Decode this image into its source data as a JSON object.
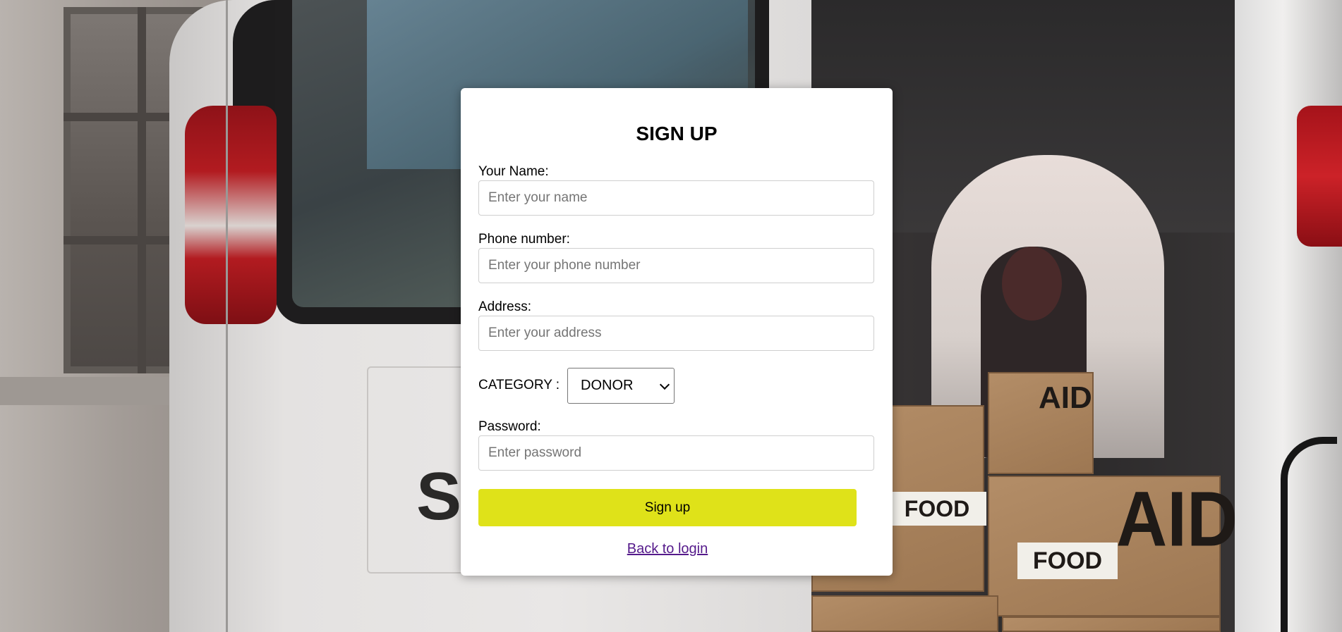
{
  "form": {
    "title": "SIGN UP",
    "name_label": "Your Name:",
    "name_placeholder": "Enter your name",
    "phone_label": "Phone number:",
    "phone_placeholder": "Enter your phone number",
    "address_label": "Address:",
    "address_placeholder": "Enter your address",
    "category_label": "CATEGORY :",
    "category_selected": "DONOR",
    "password_label": "Password:",
    "password_placeholder": "Enter password",
    "submit_label": "Sign up",
    "back_link": "Back to login"
  },
  "background": {
    "box_labels": [
      "AID",
      "AID",
      "FOOD",
      "FOOD"
    ],
    "van_letters": "SU"
  },
  "colors": {
    "button": "#dfe219",
    "link": "#551a8b",
    "card": "#ffffff"
  },
  "icons": {
    "select_arrow": "chevron-down-icon"
  }
}
